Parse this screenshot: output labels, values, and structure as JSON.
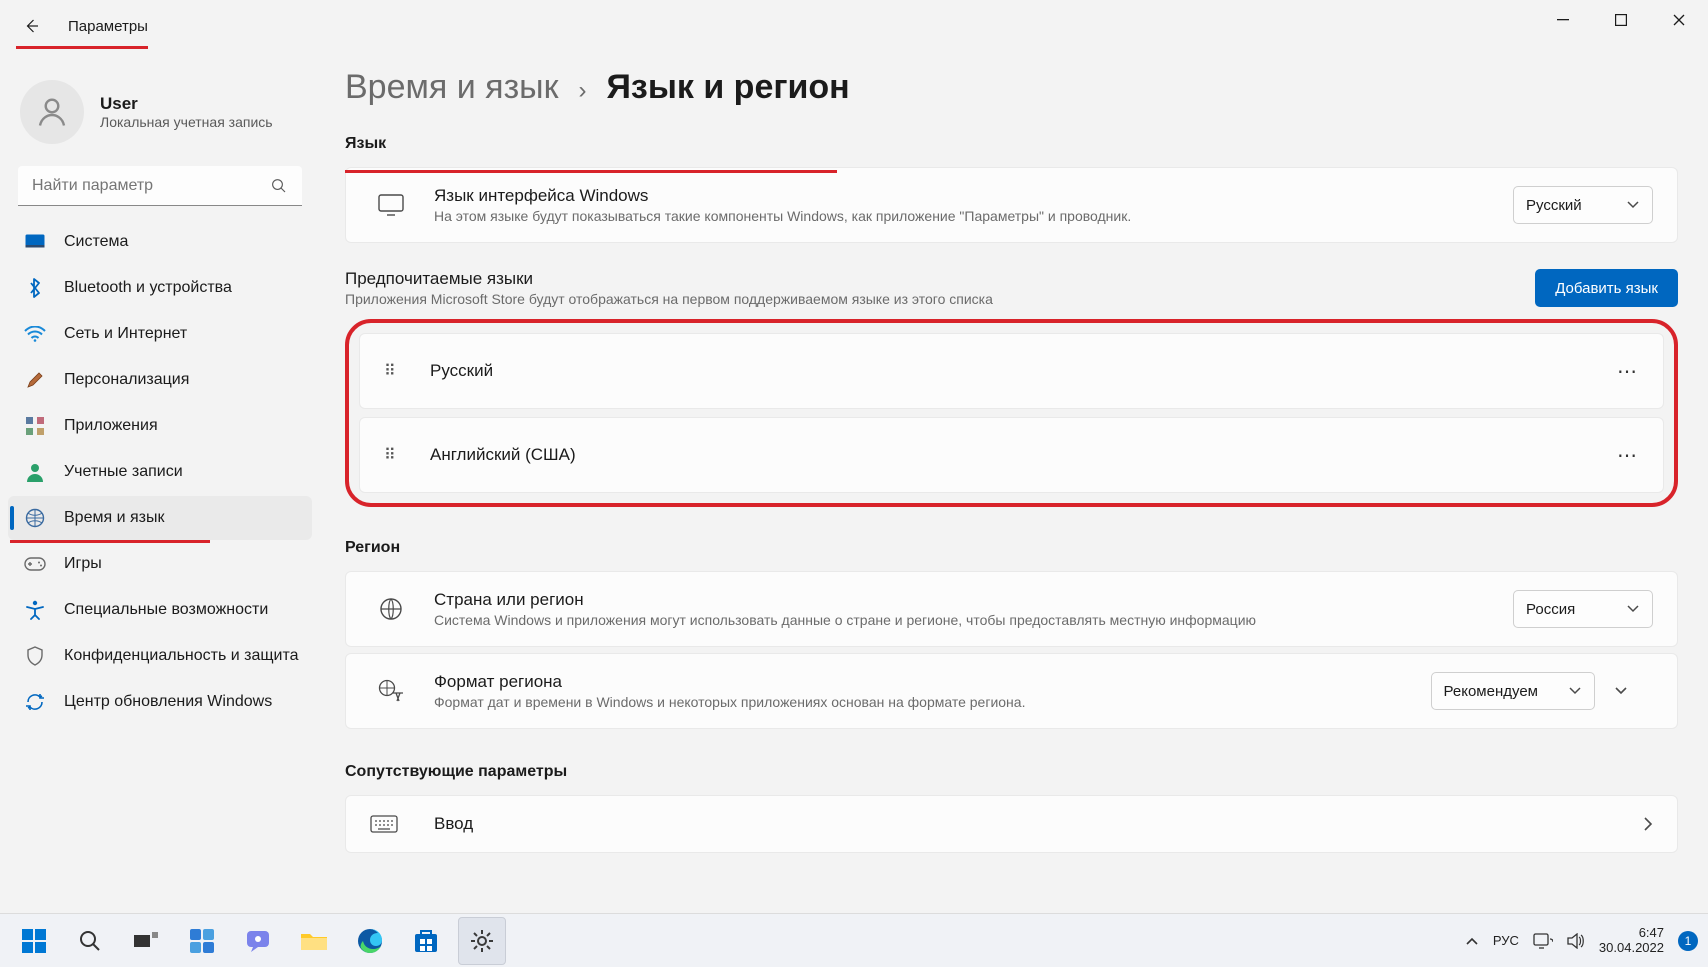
{
  "titlebar": {
    "back_aria": "Назад",
    "title": "Параметры"
  },
  "user": {
    "name": "User",
    "sub": "Локальная учетная запись"
  },
  "search": {
    "placeholder": "Найти параметр"
  },
  "nav": {
    "items": [
      {
        "label": "Система"
      },
      {
        "label": "Bluetooth и устройства"
      },
      {
        "label": "Сеть и Интернет"
      },
      {
        "label": "Персонализация"
      },
      {
        "label": "Приложения"
      },
      {
        "label": "Учетные записи"
      },
      {
        "label": "Время и язык"
      },
      {
        "label": "Игры"
      },
      {
        "label": "Специальные возможности"
      },
      {
        "label": "Конфиденциальность и защита"
      },
      {
        "label": "Центр обновления Windows"
      }
    ]
  },
  "breadcrumb": {
    "parent": "Время и язык",
    "sep": "›",
    "current": "Язык и регион"
  },
  "sections": {
    "language": "Язык",
    "region": "Регион",
    "related": "Сопутствующие параметры"
  },
  "display_lang": {
    "title": "Язык интерфейса Windows",
    "desc": "На этом языке будут показываться такие компоненты Windows, как приложение \"Параметры\" и проводник.",
    "value": "Русский"
  },
  "preferred": {
    "title": "Предпочитаемые языки",
    "desc": "Приложения Microsoft Store будут отображаться на первом поддерживаемом языке из этого списка",
    "add_btn": "Добавить язык",
    "items": [
      {
        "label": "Русский"
      },
      {
        "label": "Английский (США)"
      }
    ]
  },
  "region": {
    "country": {
      "title": "Страна или регион",
      "desc": "Система Windows и приложения могут использовать данные о стране и регионе, чтобы предоставлять местную информацию",
      "value": "Россия"
    },
    "format": {
      "title": "Формат региона",
      "desc": "Формат дат и времени в Windows и некоторых приложениях основан на формате региона.",
      "value": "Рекомендуем"
    }
  },
  "related": {
    "input": "Ввод"
  },
  "taskbar": {
    "lang": "РУС",
    "time": "6:47",
    "date": "30.04.2022",
    "badge": "1"
  }
}
